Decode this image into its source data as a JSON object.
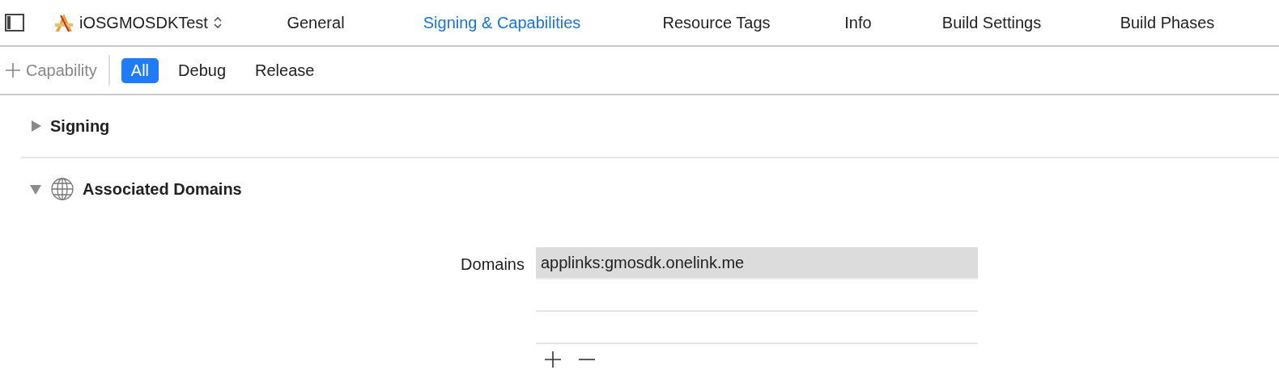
{
  "project": {
    "name": "iOSGMOSDKTest"
  },
  "tabs": [
    {
      "label": "General",
      "selected": false
    },
    {
      "label": "Signing & Capabilities",
      "selected": true
    },
    {
      "label": "Resource Tags",
      "selected": false
    },
    {
      "label": "Info",
      "selected": false
    },
    {
      "label": "Build Settings",
      "selected": false
    },
    {
      "label": "Build Phases",
      "selected": false
    }
  ],
  "toolbar": {
    "add_label": "Capability",
    "filters": [
      {
        "label": "All",
        "selected": true
      },
      {
        "label": "Debug",
        "selected": false
      },
      {
        "label": "Release",
        "selected": false
      }
    ]
  },
  "sections": [
    {
      "title": "Signing",
      "expanded": false,
      "icon": false
    },
    {
      "title": "Associated Domains",
      "expanded": true,
      "icon": true,
      "field_label": "Domains",
      "items": [
        {
          "value": "applinks:gmosdk.onelink.me",
          "selected": true
        }
      ]
    }
  ]
}
